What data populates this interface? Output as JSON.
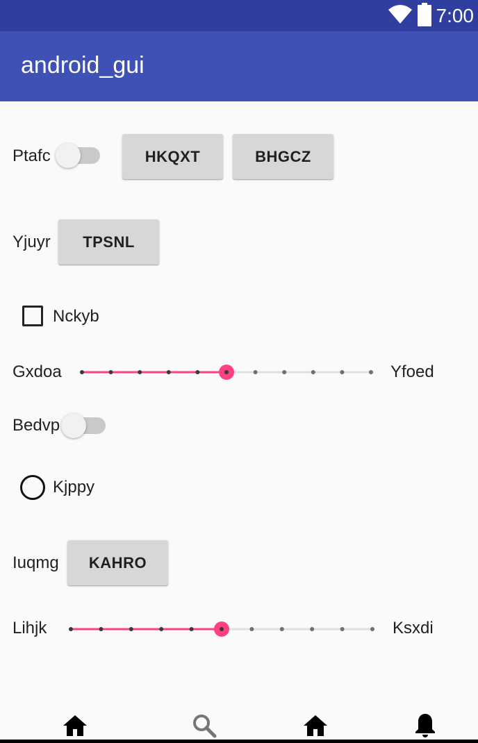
{
  "status_bar": {
    "time": "7:00",
    "icons": [
      "wifi-icon",
      "battery-icon"
    ]
  },
  "app_bar": {
    "title": "android_gui"
  },
  "rows": {
    "row1": {
      "label": "Ptafc",
      "switch_on": false,
      "button1": "HKQXT",
      "button2": "BHGCZ"
    },
    "row2": {
      "label": "Yjuyr",
      "button": "TPSNL"
    },
    "row3": {
      "checkbox_label": "Nckyb",
      "checked": false
    },
    "row4": {
      "label_left": "Gxdoa",
      "label_right": "Yfoed",
      "slider_value": 5,
      "slider_max": 10
    },
    "row5": {
      "label": "Bedvp",
      "switch_on": false
    },
    "row6": {
      "radio_label": "Kjppy",
      "selected": false
    },
    "row7": {
      "label": "Iuqmg",
      "button": "KAHRO"
    },
    "row8": {
      "label_left": "Lihjk",
      "label_right": "Ksxdi",
      "slider_value": 5,
      "slider_max": 10
    }
  },
  "bottom_nav": {
    "items": [
      "home-icon",
      "search-icon",
      "home-icon",
      "bell-icon"
    ]
  },
  "colors": {
    "primary": "#3f51b5",
    "primary_dark": "#303f9f",
    "accent": "#ff4081",
    "button": "#d6d7d7"
  }
}
